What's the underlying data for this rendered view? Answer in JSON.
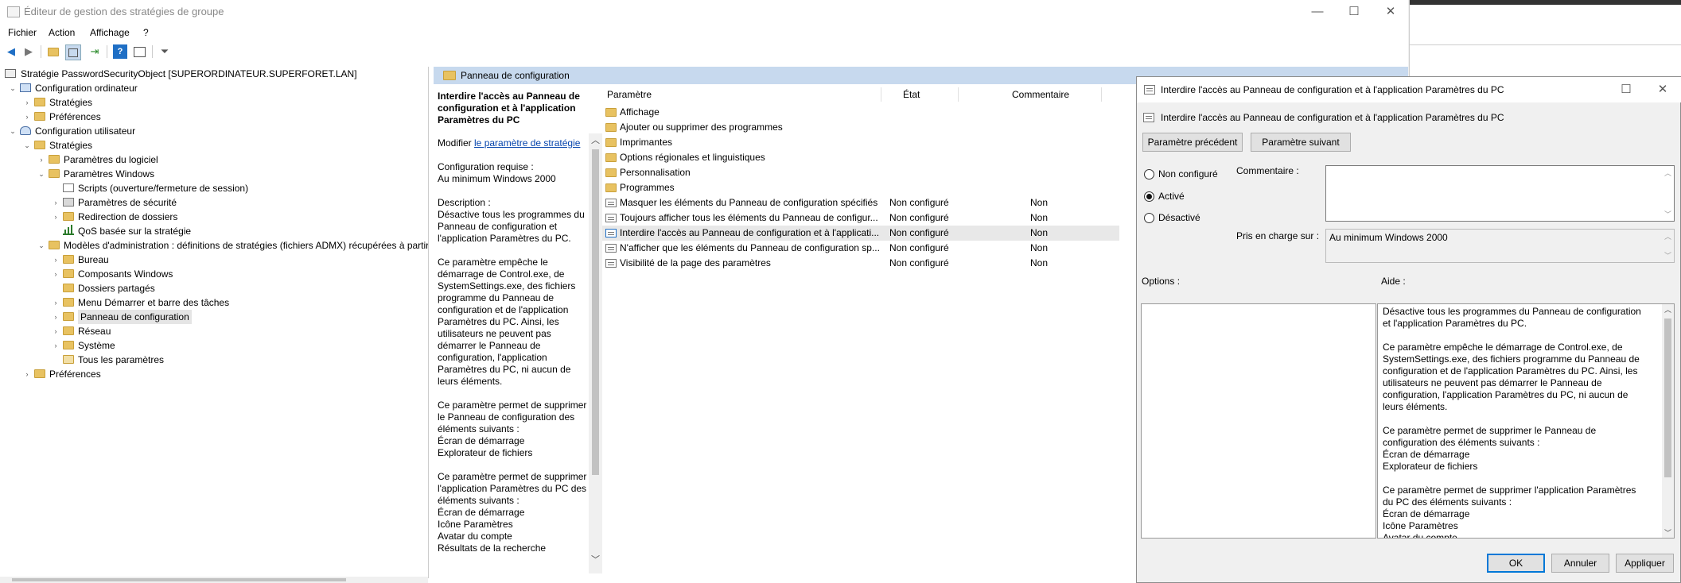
{
  "window": {
    "title": "Éditeur de gestion des stratégies de groupe",
    "minimize": "—",
    "maximize": "☐",
    "close": "✕"
  },
  "menu": [
    "Fichier",
    "Action",
    "Affichage",
    "?"
  ],
  "tree": {
    "root": "Stratégie PasswordSecurityObject [SUPERORDINATEUR.SUPERFORET.LAN]",
    "nodes": [
      {
        "label": "Configuration ordinateur"
      },
      {
        "label": "Stratégies"
      },
      {
        "label": "Préférences"
      },
      {
        "label": "Configuration utilisateur"
      },
      {
        "label": "Stratégies"
      },
      {
        "label": "Paramètres du logiciel"
      },
      {
        "label": "Paramètres Windows"
      },
      {
        "label": "Scripts (ouverture/fermeture de session)"
      },
      {
        "label": "Paramètres de sécurité"
      },
      {
        "label": "Redirection de dossiers"
      },
      {
        "label": "QoS basée sur la stratégie"
      },
      {
        "label": "Modèles d'administration : définitions de stratégies (fichiers ADMX) récupérées à partir"
      },
      {
        "label": "Bureau"
      },
      {
        "label": "Composants Windows"
      },
      {
        "label": "Dossiers partagés"
      },
      {
        "label": "Menu Démarrer et barre des tâches"
      },
      {
        "label": "Panneau de configuration"
      },
      {
        "label": "Réseau"
      },
      {
        "label": "Système"
      },
      {
        "label": "Tous les paramètres"
      },
      {
        "label": "Préférences"
      }
    ]
  },
  "pane": {
    "header": "Panneau de configuration",
    "desc_title": "Interdire l'accès au Panneau de configuration et à l'application Paramètres du PC",
    "modify_prefix": "Modifier ",
    "modify_link": "le paramètre de stratégie",
    "requirement": "Configuration requise :\nAu minimum Windows 2000",
    "description": "Description :\nDésactive tous les programmes du Panneau de configuration et l'application Paramètres du PC.\n\nCe paramètre empêche le démarrage de Control.exe, de SystemSettings.exe, des fichiers programme du Panneau de configuration et de l'application Paramètres du PC. Ainsi, les utilisateurs ne peuvent pas démarrer le Panneau de configuration, l'application Paramètres du PC, ni aucun de leurs éléments.\n\nCe paramètre permet de supprimer le Panneau de configuration des éléments suivants :\nÉcran de démarrage\nExplorateur de fichiers\n\nCe paramètre permet de supprimer l'application Paramètres du PC des éléments suivants :\nÉcran de démarrage\nIcône Paramètres\nAvatar du compte\nRésultats de la recherche"
  },
  "list": {
    "columns": {
      "name": "Paramètre",
      "state": "État",
      "comment": "Commentaire"
    },
    "rows": [
      {
        "type": "folder",
        "name": "Affichage",
        "state": "",
        "comment": ""
      },
      {
        "type": "folder",
        "name": "Ajouter ou supprimer des programmes",
        "state": "",
        "comment": ""
      },
      {
        "type": "folder",
        "name": "Imprimantes",
        "state": "",
        "comment": ""
      },
      {
        "type": "folder",
        "name": "Options régionales et linguistiques",
        "state": "",
        "comment": ""
      },
      {
        "type": "folder",
        "name": "Personnalisation",
        "state": "",
        "comment": ""
      },
      {
        "type": "folder",
        "name": "Programmes",
        "state": "",
        "comment": ""
      },
      {
        "type": "policy",
        "name": "Masquer les éléments du Panneau de configuration spécifiés",
        "state": "Non configuré",
        "comment": "Non"
      },
      {
        "type": "policy",
        "name": "Toujours afficher tous les éléments du Panneau de configur...",
        "state": "Non configuré",
        "comment": "Non"
      },
      {
        "type": "policy",
        "name": "Interdire l'accès au Panneau de configuration et à l'applicati...",
        "state": "Non configuré",
        "comment": "Non"
      },
      {
        "type": "policy",
        "name": "N'afficher que les éléments du Panneau de configuration sp...",
        "state": "Non configuré",
        "comment": "Non"
      },
      {
        "type": "policy",
        "name": "Visibilité de la page des paramètres",
        "state": "Non configuré",
        "comment": "Non"
      }
    ]
  },
  "dialog": {
    "title": "Interdire l'accès au Panneau de configuration et à l'application Paramètres du PC",
    "subtitle": "Interdire l'accès au Panneau de configuration et à l'application Paramètres du PC",
    "prev_button": "Paramètre précédent",
    "next_button": "Paramètre suivant",
    "radios": [
      {
        "label": "Non configuré",
        "checked": false
      },
      {
        "label": "Activé",
        "checked": true
      },
      {
        "label": "Désactivé",
        "checked": false
      }
    ],
    "comment_label": "Commentaire :",
    "comment_value": "",
    "supported_label": "Pris en charge sur :",
    "supported_value": "Au minimum Windows 2000",
    "options_label": "Options :",
    "help_label": "Aide :",
    "help_text": "Désactive tous les programmes du Panneau de configuration et l'application Paramètres du PC.\n\nCe paramètre empêche le démarrage de Control.exe, de SystemSettings.exe, des fichiers programme du Panneau de configuration et de l'application Paramètres du PC. Ainsi, les utilisateurs ne peuvent pas démarrer le Panneau de configuration, l'application Paramètres du PC, ni aucun de leurs éléments.\n\nCe paramètre permet de supprimer le Panneau de configuration des éléments suivants :\nÉcran de démarrage\nExplorateur de fichiers\n\nCe paramètre permet de supprimer l'application Paramètres du PC des éléments suivants :\nÉcran de démarrage\nIcône Paramètres\nAvatar du compte",
    "ok": "OK",
    "cancel": "Annuler",
    "apply": "Appliquer"
  },
  "colors": {
    "selection": "#c7d9ee",
    "folder": "#e8c261",
    "link": "#0645ad",
    "primary_border": "#0078d7"
  }
}
